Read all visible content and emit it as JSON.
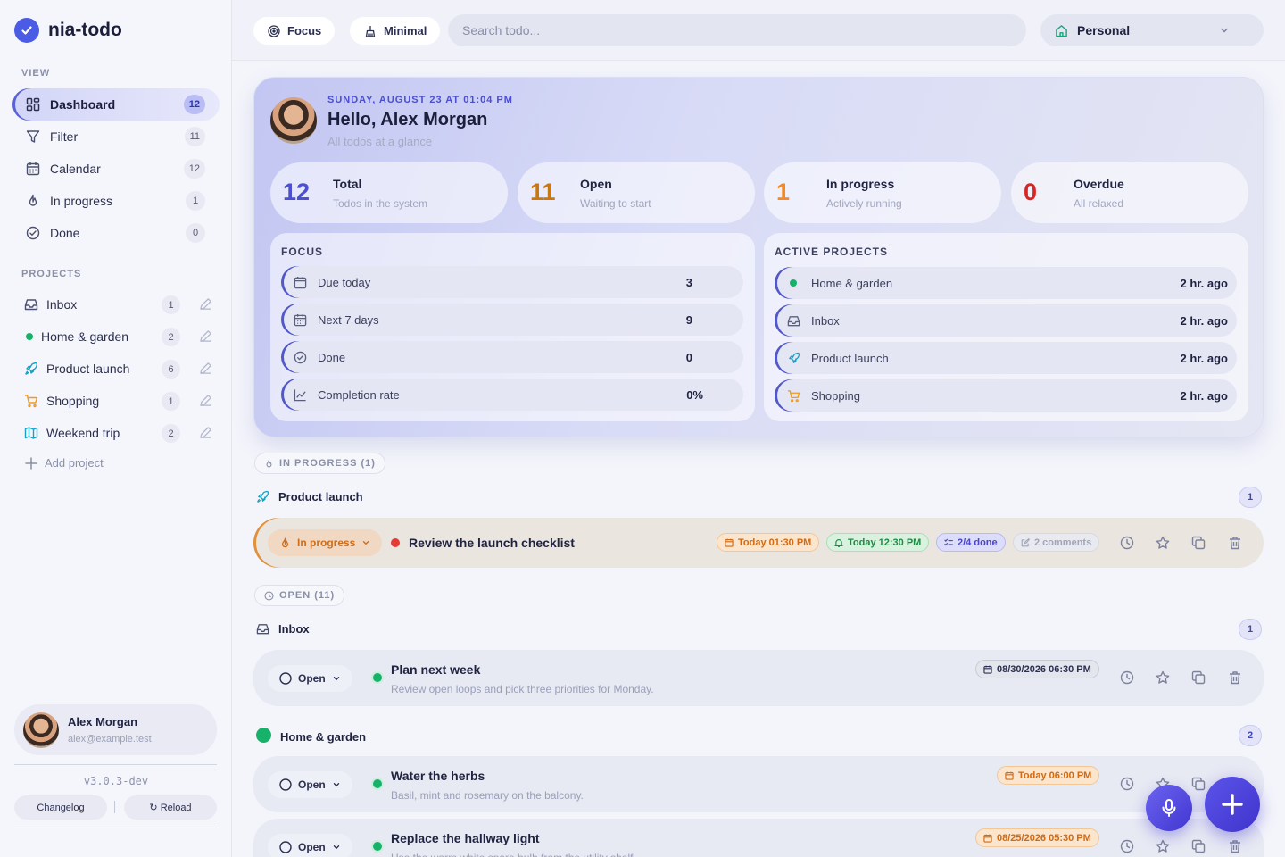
{
  "app": {
    "name": "nia-todo"
  },
  "sidebar": {
    "view_label": "VIEW",
    "nav": [
      {
        "label": "Dashboard",
        "count": "12"
      },
      {
        "label": "Filter",
        "count": "11"
      },
      {
        "label": "Calendar",
        "count": "12"
      },
      {
        "label": "In progress",
        "count": "1"
      },
      {
        "label": "Done",
        "count": "0"
      }
    ],
    "projects_label": "PROJECTS",
    "projects": [
      {
        "label": "Inbox",
        "count": "1",
        "icon": "inbox-icon"
      },
      {
        "label": "Home & garden",
        "count": "2",
        "icon": "green-dot",
        "color": "#17b26a"
      },
      {
        "label": "Product launch",
        "count": "6",
        "icon": "rocket-icon",
        "color": "#14a3c7"
      },
      {
        "label": "Shopping",
        "count": "1",
        "icon": "cart-icon",
        "color": "#f29a1a"
      },
      {
        "label": "Weekend trip",
        "count": "2",
        "icon": "map-icon",
        "color": "#14a3c7"
      }
    ],
    "add_project": "Add project",
    "user": {
      "name": "Alex Morgan",
      "email": "alex@example.test"
    },
    "version": "v3.0.3-dev",
    "changelog": "Changelog",
    "reload": "↻ Reload"
  },
  "topbar": {
    "focus": "Focus",
    "minimal": "Minimal",
    "search_placeholder": "Search todo...",
    "workspace": "Personal"
  },
  "dashboard": {
    "date": "SUNDAY, AUGUST 23 AT 01:04 PM",
    "greeting": "Hello, Alex Morgan",
    "subtitle": "All todos at a glance",
    "stats": [
      {
        "value": "12",
        "label": "Total",
        "sub": "Todos in the system",
        "color": "#4b4fd0"
      },
      {
        "value": "11",
        "label": "Open",
        "sub": "Waiting to start",
        "color": "#c8780f"
      },
      {
        "value": "1",
        "label": "In progress",
        "sub": "Actively running",
        "color": "#f28a2a"
      },
      {
        "value": "0",
        "label": "Overdue",
        "sub": "All relaxed",
        "color": "#d92525"
      }
    ],
    "focus_title": "FOCUS",
    "focus": [
      {
        "label": "Due today",
        "value": "3"
      },
      {
        "label": "Next 7 days",
        "value": "9"
      },
      {
        "label": "Done",
        "value": "0"
      },
      {
        "label": "Completion rate",
        "value": "0%"
      }
    ],
    "projects_title": "ACTIVE PROJECTS",
    "active_projects": [
      {
        "label": "Home & garden",
        "value": "2 hr. ago"
      },
      {
        "label": "Inbox",
        "value": "2 hr. ago"
      },
      {
        "label": "Product launch",
        "value": "2 hr. ago"
      },
      {
        "label": "Shopping",
        "value": "2 hr. ago"
      }
    ]
  },
  "lists": {
    "in_progress": {
      "label": "IN PROGRESS (1)",
      "group": {
        "name": "Product launch",
        "count": "1"
      },
      "todo": {
        "status": "In progress",
        "title": "Review the launch checklist",
        "due": "Today 01:30 PM",
        "reminder": "Today 12:30 PM",
        "subtasks": "2/4 done",
        "comments": "2 comments",
        "priority_color": "#e53935"
      }
    },
    "open": {
      "label": "OPEN (11)",
      "groups": [
        {
          "name": "Inbox",
          "count": "1",
          "todos": [
            {
              "status": "Open",
              "title": "Plan next week",
              "sub": "Review open loops and pick three priorities for Monday.",
              "date": "08/30/2026 06:30 PM"
            }
          ]
        },
        {
          "name": "Home & garden",
          "count": "2",
          "todos": [
            {
              "status": "Open",
              "title": "Water the herbs",
              "sub": "Basil, mint and rosemary on the balcony.",
              "date": "Today 06:00 PM"
            },
            {
              "status": "Open",
              "title": "Replace the hallway light",
              "sub": "Use the warm white spare bulb from the utility shelf.",
              "date": "08/25/2026 05:30 PM"
            }
          ]
        }
      ]
    }
  }
}
